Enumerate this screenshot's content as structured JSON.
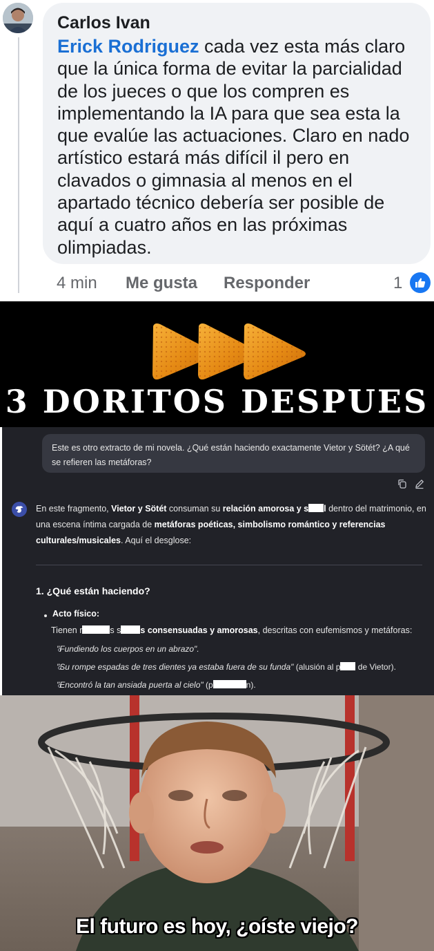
{
  "comment": {
    "author": "Carlos Ivan",
    "mention": "Erick Rodriguez",
    "text": " cada vez esta más claro\nque la única forma de evitar la parcialidad\nde los jueces o que los compren es\nimplementando la IA para que sea esta la\nque evalúe las actuaciones. Claro en nado\nartístico estará más difícil il pero en\nclavados o gimnasia al menos en el\napartado técnico debería ser posible de\naquí a cuatro años en las próximas\nolimpiadas.",
    "time": "4 min",
    "like_label": "Me gusta",
    "reply_label": "Responder",
    "reaction_count": "1",
    "reaction_icon": "thumbs-up-icon",
    "colors": {
      "mention": "#1a6fd4",
      "reaction": "#1877f2",
      "bubble": "#f0f2f5"
    }
  },
  "doritos": {
    "title": "3 DORITOS DESPUES",
    "count": 3
  },
  "chat": {
    "user_message": "Este es otro extracto de mi novela. ¿Qué están haciendo exactamente Vietor y Sötét? ¿A qué se refieren las metáforas?",
    "intro": {
      "p1": "En este fragmento, ",
      "b1": "Vietor y Sötét",
      "p2": " consuman su ",
      "b2": "relación amorosa y s",
      "b3": "l",
      "p3": " dentro del matrimonio, en una escena íntima cargada de ",
      "b4": "metáforas poéticas, simbolismo romántico y referencias culturales/musicales",
      "p4": ". Aquí el desglose:"
    },
    "section_heading": "1. ¿Qué están haciendo?",
    "bullet_title": "Acto físico:",
    "bullet_line": {
      "p1": "Tienen r",
      "p2": "s s",
      "b1": "s consensuadas y amorosas",
      "p3": ", descritas con eufemismos y metáforas:"
    },
    "quotes": [
      {
        "quote": "\"Fundiendo los cuerpos en un abrazo\".",
        "note": ""
      },
      {
        "quote": "\"Su rompe espadas de tres dientes ya estaba fuera de su funda\"",
        "note": " (alusión al p",
        "note_end": " de Vietor)."
      },
      {
        "quote": "\"Encontró la tan ansiada puerta al cielo\"",
        "note": " (p",
        "note_end": "n)."
      }
    ],
    "colors": {
      "background": "#212228",
      "user_bubble": "#363841",
      "ai_avatar": "#3b4ea8"
    }
  },
  "photo": {
    "caption": "El futuro es hoy, ¿oíste viejo?"
  }
}
